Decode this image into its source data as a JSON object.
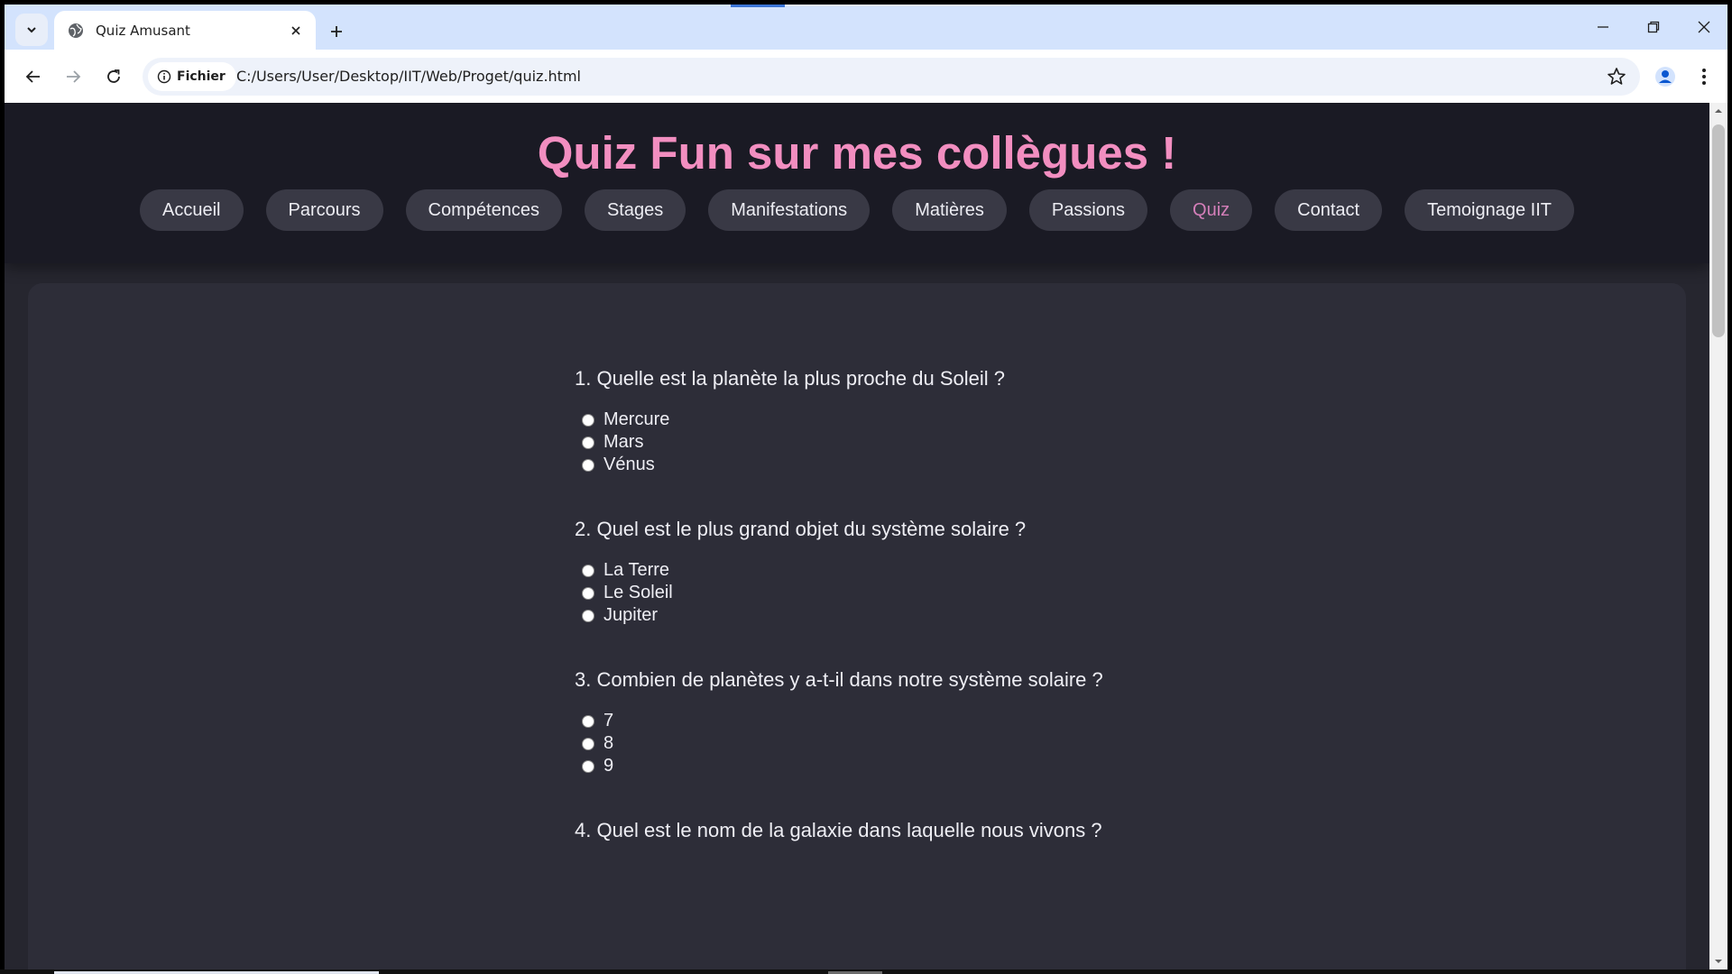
{
  "browser": {
    "tab_title": "Quiz Amusant",
    "security_chip": "Fichier",
    "url": "C:/Users/User/Desktop/IIT/Web/Proget/quiz.html"
  },
  "site": {
    "title": "Quiz Fun sur mes collègues !",
    "nav": [
      "Accueil",
      "Parcours",
      "Compétences",
      "Stages",
      "Manifestations",
      "Matières",
      "Passions",
      "Quiz",
      "Contact",
      "Temoignage IIT"
    ],
    "active_nav": "Quiz"
  },
  "quiz": {
    "questions": [
      {
        "text": "1. Quelle est la planète la plus proche du Soleil ?",
        "options": [
          "Mercure",
          "Mars",
          "Vénus"
        ]
      },
      {
        "text": "2. Quel est le plus grand objet du système solaire ?",
        "options": [
          "La Terre",
          "Le Soleil",
          "Jupiter"
        ]
      },
      {
        "text": "3. Combien de planètes y a-t-il dans notre système solaire ?",
        "options": [
          "7",
          "8",
          "9"
        ]
      },
      {
        "text": "4. Quel est le nom de la galaxie dans laquelle nous vivons ?",
        "options": []
      }
    ]
  },
  "colors": {
    "title_pink": "#f28ec0",
    "active_nav": "#d47fb9",
    "header_bg": "#1a1a24",
    "card_bg": "#2d2d38"
  }
}
